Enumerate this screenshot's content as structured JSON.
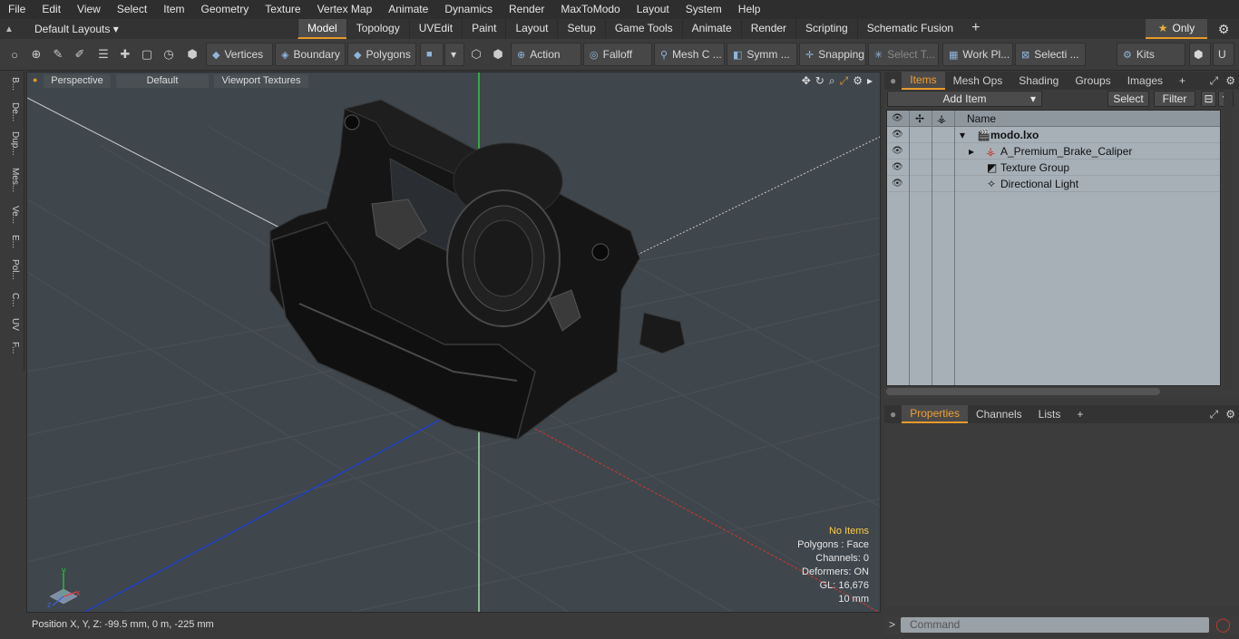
{
  "menu": [
    "File",
    "Edit",
    "View",
    "Select",
    "Item",
    "Geometry",
    "Texture",
    "Vertex Map",
    "Animate",
    "Dynamics",
    "Render",
    "MaxToModo",
    "Layout",
    "System",
    "Help"
  ],
  "layouts": {
    "label": "Default Layouts"
  },
  "tabs": [
    "Model",
    "Topology",
    "UVEdit",
    "Paint",
    "Layout",
    "Setup",
    "Game Tools",
    "Animate",
    "Render",
    "Scripting",
    "Schematic Fusion"
  ],
  "only_label": "Only",
  "toolbar": {
    "vertices": "Vertices",
    "boundary": "Boundary",
    "polygons": "Polygons",
    "action": "Action",
    "falloff": "Falloff",
    "mesh": "Mesh C ...",
    "symm": "Symm ...",
    "snapping": "Snapping",
    "select_t": "Select T...",
    "workpl": "Work Pl...",
    "selecti": "Selecti ...",
    "kits": "Kits"
  },
  "left_tabs": [
    "B...",
    "De...",
    "Dup...",
    "Mes...",
    "Ve...",
    "E...",
    "Pol...",
    "C...",
    "UV",
    "F..."
  ],
  "viewport": {
    "perspective": "Perspective",
    "default": "Default",
    "textures": "Viewport Textures",
    "stats": {
      "items": "No Items",
      "polygons": "Polygons : Face",
      "channels": "Channels: 0",
      "deformers": "Deformers: ON",
      "gl": "GL: 16,676",
      "scale": "10 mm"
    }
  },
  "status": "Position X, Y, Z:  -99.5 mm, 0 m, -225 mm",
  "items_panel": {
    "tabs": [
      "Items",
      "Mesh Ops",
      "Shading",
      "Groups",
      "Images"
    ],
    "add_item": "Add Item",
    "select": "Select",
    "filter": "Filter",
    "name_header": "Name",
    "rows": [
      "modo.lxo",
      "A_Premium_Brake_Caliper",
      "Texture Group",
      "Directional Light"
    ]
  },
  "props_panel": {
    "tabs": [
      "Properties",
      "Channels",
      "Lists"
    ]
  },
  "command": {
    "placeholder": "Command"
  },
  "colors": {
    "accent": "#e69a2b",
    "axis_x": "#c0392b",
    "axis_y": "#2ecc40",
    "axis_z": "#2040c0"
  }
}
